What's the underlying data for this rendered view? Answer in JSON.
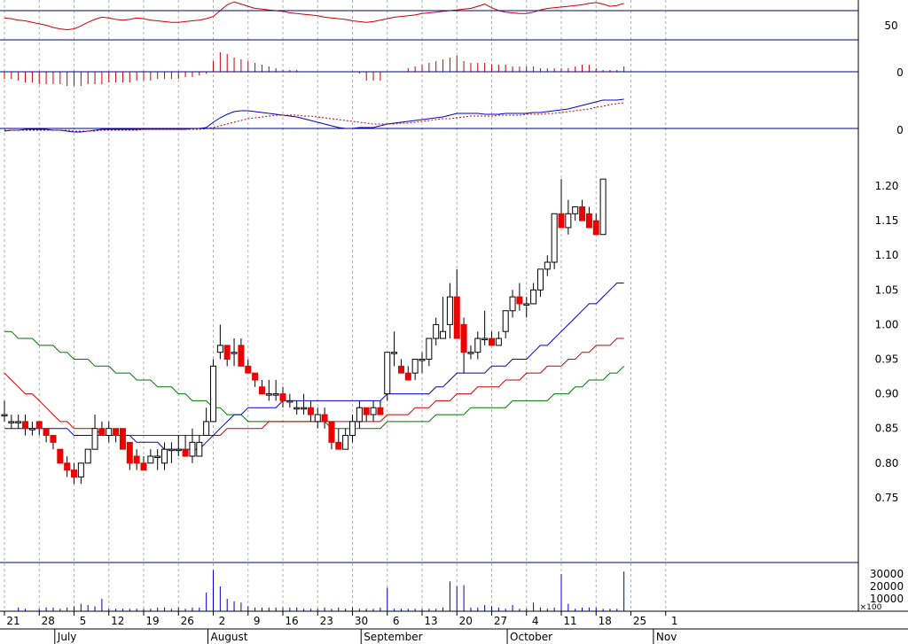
{
  "chart_data": {
    "type": "candlestick",
    "rsi_panel": {
      "ticks": [
        "50"
      ],
      "guide_levels": [
        70,
        30
      ],
      "values": [
        60,
        59,
        57,
        56,
        54,
        52,
        50,
        47,
        45,
        44,
        45,
        49,
        54,
        58,
        61,
        60,
        58,
        57,
        58,
        60,
        59,
        57,
        56,
        55,
        54,
        54,
        55,
        56,
        57,
        59,
        62,
        70,
        78,
        82,
        79,
        76,
        73,
        72,
        71,
        70,
        69,
        67,
        66,
        65,
        64,
        63,
        61,
        60,
        59,
        58,
        56,
        55,
        54,
        55,
        57,
        59,
        61,
        62,
        63,
        64,
        66,
        67,
        68,
        69,
        70,
        71,
        72,
        73,
        76,
        79,
        74,
        70,
        68,
        67,
        66,
        66,
        68,
        71,
        73,
        74,
        75,
        76,
        77,
        78,
        80,
        81,
        79,
        76,
        77,
        80
      ]
    },
    "macd_hist_panel": {
      "ticks": [
        "0"
      ],
      "values": [
        -4,
        -4,
        -5,
        -6,
        -6,
        -7,
        -7,
        -7,
        -7,
        -8,
        -8,
        -8,
        -7,
        -7,
        -7,
        -6,
        -6,
        -6,
        -6,
        -5,
        -5,
        -5,
        -4,
        -4,
        -4,
        -4,
        -3,
        -3,
        -2,
        -1,
        6,
        11,
        10,
        8,
        7,
        6,
        5,
        4,
        3,
        2,
        1,
        1,
        1,
        0,
        0,
        0,
        0,
        0,
        0,
        0,
        0,
        -1,
        -5,
        -5,
        -5,
        0,
        0,
        0,
        2,
        3,
        4,
        5,
        6,
        7,
        8,
        9,
        6,
        5,
        5,
        5,
        4,
        4,
        4,
        3,
        3,
        3,
        3,
        2,
        2,
        2,
        2,
        2,
        3,
        4,
        4,
        2,
        1,
        1,
        1,
        3
      ]
    },
    "macd_line_panel": {
      "ticks": [
        "0"
      ],
      "macd": [
        -3,
        -2,
        -2,
        -1,
        -1,
        -1,
        -1,
        -2,
        -2,
        -3,
        -4,
        -4,
        -3,
        -2,
        -1,
        -1,
        -1,
        -1,
        -1,
        -1,
        -1,
        -1,
        -1,
        -1,
        -1,
        -1,
        -1,
        0,
        0,
        1,
        7,
        12,
        16,
        19,
        20,
        20,
        19,
        18,
        17,
        16,
        15,
        14,
        13,
        11,
        9,
        7,
        5,
        3,
        1,
        0,
        0,
        1,
        1,
        1,
        3,
        5,
        6,
        7,
        8,
        9,
        10,
        11,
        12,
        13,
        15,
        17,
        17,
        17,
        17,
        16,
        16,
        16,
        17,
        17,
        17,
        17,
        18,
        18,
        19,
        20,
        21,
        22,
        24,
        26,
        28,
        30,
        32,
        32,
        32,
        33
      ],
      "signal": [
        -2,
        -2,
        -2,
        -2,
        -2,
        -2,
        -2,
        -2,
        -2,
        -2,
        -3,
        -3,
        -3,
        -3,
        -2,
        -2,
        -2,
        -2,
        -2,
        -2,
        -1,
        -1,
        -1,
        -1,
        -1,
        -1,
        -1,
        -1,
        -1,
        0,
        1,
        3,
        5,
        7,
        9,
        11,
        12,
        13,
        14,
        15,
        15,
        15,
        15,
        14,
        14,
        13,
        12,
        11,
        10,
        9,
        8,
        7,
        6,
        5,
        5,
        5,
        5,
        6,
        6,
        7,
        8,
        9,
        10,
        11,
        11,
        12,
        13,
        14,
        14,
        14,
        14,
        15,
        15,
        15,
        15,
        16,
        16,
        16,
        17,
        17,
        18,
        19,
        20,
        21,
        22,
        24,
        25,
        27,
        28,
        29
      ]
    },
    "price_panel": {
      "y_ticks": [
        "1.20",
        "1.15",
        "1.10",
        "1.05",
        "1.00",
        "0.95",
        "0.90",
        "0.85",
        "0.80",
        "0.75"
      ],
      "ylim": [
        0.73,
        1.23
      ],
      "candles": [
        [
          0.87,
          0.89,
          0.86,
          0.87
        ],
        [
          0.86,
          0.87,
          0.85,
          0.86
        ],
        [
          0.86,
          0.87,
          0.85,
          0.86
        ],
        [
          0.86,
          0.87,
          0.84,
          0.85
        ],
        [
          0.85,
          0.86,
          0.84,
          0.85
        ],
        [
          0.86,
          0.86,
          0.84,
          0.85
        ],
        [
          0.85,
          0.85,
          0.83,
          0.84
        ],
        [
          0.84,
          0.84,
          0.82,
          0.83
        ],
        [
          0.82,
          0.82,
          0.8,
          0.8
        ],
        [
          0.8,
          0.81,
          0.78,
          0.79
        ],
        [
          0.79,
          0.8,
          0.77,
          0.78
        ],
        [
          0.78,
          0.8,
          0.77,
          0.8
        ],
        [
          0.8,
          0.82,
          0.8,
          0.82
        ],
        [
          0.82,
          0.87,
          0.82,
          0.85
        ],
        [
          0.85,
          0.86,
          0.84,
          0.84
        ],
        [
          0.84,
          0.86,
          0.83,
          0.85
        ],
        [
          0.85,
          0.85,
          0.83,
          0.84
        ],
        [
          0.85,
          0.85,
          0.83,
          0.82
        ],
        [
          0.83,
          0.83,
          0.79,
          0.8
        ],
        [
          0.81,
          0.82,
          0.79,
          0.8
        ],
        [
          0.8,
          0.81,
          0.79,
          0.79
        ],
        [
          0.8,
          0.82,
          0.8,
          0.81
        ],
        [
          0.81,
          0.82,
          0.79,
          0.81
        ],
        [
          0.8,
          0.83,
          0.79,
          0.82
        ],
        [
          0.82,
          0.83,
          0.8,
          0.82
        ],
        [
          0.82,
          0.84,
          0.81,
          0.82
        ],
        [
          0.82,
          0.84,
          0.81,
          0.81
        ],
        [
          0.81,
          0.85,
          0.8,
          0.83
        ],
        [
          0.81,
          0.84,
          0.81,
          0.83
        ],
        [
          0.84,
          0.88,
          0.84,
          0.86
        ],
        [
          0.86,
          0.95,
          0.86,
          0.94
        ],
        [
          0.96,
          1.0,
          0.95,
          0.97
        ],
        [
          0.97,
          0.97,
          0.94,
          0.95
        ],
        [
          0.96,
          0.98,
          0.94,
          0.96
        ],
        [
          0.97,
          0.98,
          0.94,
          0.94
        ],
        [
          0.94,
          0.95,
          0.93,
          0.93
        ],
        [
          0.93,
          0.93,
          0.91,
          0.92
        ],
        [
          0.91,
          0.92,
          0.9,
          0.9
        ],
        [
          0.9,
          0.92,
          0.89,
          0.9
        ],
        [
          0.9,
          0.92,
          0.89,
          0.9
        ],
        [
          0.9,
          0.91,
          0.88,
          0.89
        ],
        [
          0.89,
          0.9,
          0.88,
          0.89
        ],
        [
          0.88,
          0.89,
          0.87,
          0.88
        ],
        [
          0.88,
          0.9,
          0.87,
          0.88
        ],
        [
          0.88,
          0.89,
          0.86,
          0.87
        ],
        [
          0.86,
          0.88,
          0.85,
          0.87
        ],
        [
          0.87,
          0.88,
          0.85,
          0.86
        ],
        [
          0.86,
          0.86,
          0.82,
          0.83
        ],
        [
          0.83,
          0.85,
          0.82,
          0.82
        ],
        [
          0.82,
          0.85,
          0.82,
          0.84
        ],
        [
          0.84,
          0.87,
          0.83,
          0.86
        ],
        [
          0.86,
          0.89,
          0.85,
          0.88
        ],
        [
          0.88,
          0.88,
          0.86,
          0.87
        ],
        [
          0.87,
          0.89,
          0.86,
          0.88
        ],
        [
          0.88,
          0.89,
          0.87,
          0.87
        ],
        [
          0.9,
          0.96,
          0.89,
          0.96
        ],
        [
          0.96,
          0.99,
          0.94,
          0.96
        ],
        [
          0.94,
          0.95,
          0.93,
          0.93
        ],
        [
          0.93,
          0.94,
          0.92,
          0.92
        ],
        [
          0.93,
          0.95,
          0.92,
          0.95
        ],
        [
          0.95,
          0.96,
          0.93,
          0.95
        ],
        [
          0.95,
          0.98,
          0.94,
          0.98
        ],
        [
          0.98,
          1.01,
          0.97,
          1.0
        ],
        [
          0.98,
          1.04,
          0.98,
          0.99
        ],
        [
          1.0,
          1.06,
          0.98,
          1.04
        ],
        [
          1.04,
          1.08,
          0.98,
          0.98
        ],
        [
          1.0,
          1.01,
          0.93,
          0.96
        ],
        [
          0.96,
          0.97,
          0.95,
          0.96
        ],
        [
          0.96,
          0.99,
          0.95,
          0.98
        ],
        [
          0.98,
          1.02,
          0.97,
          0.98
        ],
        [
          0.98,
          0.99,
          0.97,
          0.97
        ],
        [
          0.97,
          0.99,
          0.97,
          0.98
        ],
        [
          0.99,
          1.02,
          0.98,
          1.02
        ],
        [
          1.02,
          1.05,
          1.01,
          1.04
        ],
        [
          1.04,
          1.06,
          1.02,
          1.03
        ],
        [
          1.03,
          1.04,
          1.01,
          1.03
        ],
        [
          1.03,
          1.06,
          1.03,
          1.05
        ],
        [
          1.05,
          1.07,
          1.04,
          1.08
        ],
        [
          1.08,
          1.1,
          1.07,
          1.09
        ],
        [
          1.09,
          1.16,
          1.08,
          1.16
        ],
        [
          1.16,
          1.21,
          1.15,
          1.14
        ],
        [
          1.14,
          1.18,
          1.13,
          1.16
        ],
        [
          1.16,
          1.17,
          1.15,
          1.17
        ],
        [
          1.17,
          1.18,
          1.15,
          1.15
        ],
        [
          1.16,
          1.17,
          1.14,
          1.14
        ],
        [
          1.15,
          1.16,
          1.14,
          1.13
        ],
        [
          1.13,
          1.21,
          1.13,
          1.21
        ]
      ],
      "ma_short": [
        0.85,
        0.85,
        0.85,
        0.85,
        0.85,
        0.85,
        0.85,
        0.85,
        0.85,
        0.85,
        0.84,
        0.84,
        0.84,
        0.84,
        0.84,
        0.84,
        0.84,
        0.84,
        0.84,
        0.83,
        0.83,
        0.83,
        0.83,
        0.82,
        0.82,
        0.82,
        0.82,
        0.82,
        0.82,
        0.83,
        0.84,
        0.85,
        0.86,
        0.87,
        0.87,
        0.88,
        0.88,
        0.88,
        0.88,
        0.88,
        0.89,
        0.89,
        0.89,
        0.89,
        0.89,
        0.89,
        0.89,
        0.89,
        0.89,
        0.89,
        0.89,
        0.89,
        0.89,
        0.89,
        0.89,
        0.9,
        0.9,
        0.9,
        0.9,
        0.9,
        0.9,
        0.9,
        0.91,
        0.91,
        0.92,
        0.93,
        0.93,
        0.93,
        0.93,
        0.93,
        0.94,
        0.94,
        0.94,
        0.95,
        0.95,
        0.95,
        0.96,
        0.97,
        0.97,
        0.98,
        0.99,
        1.0,
        1.01,
        1.02,
        1.03,
        1.03,
        1.04,
        1.05,
        1.06,
        1.06
      ],
      "ma_mid": [
        0.93,
        0.92,
        0.91,
        0.9,
        0.9,
        0.89,
        0.88,
        0.87,
        0.86,
        0.86,
        0.85,
        0.85,
        0.85,
        0.85,
        0.84,
        0.84,
        0.84,
        0.84,
        0.84,
        0.84,
        0.84,
        0.84,
        0.84,
        0.84,
        0.84,
        0.84,
        0.84,
        0.84,
        0.84,
        0.84,
        0.84,
        0.84,
        0.85,
        0.85,
        0.85,
        0.85,
        0.85,
        0.85,
        0.86,
        0.86,
        0.86,
        0.86,
        0.86,
        0.86,
        0.86,
        0.86,
        0.86,
        0.86,
        0.86,
        0.86,
        0.86,
        0.86,
        0.86,
        0.86,
        0.86,
        0.87,
        0.87,
        0.87,
        0.87,
        0.88,
        0.88,
        0.88,
        0.89,
        0.89,
        0.89,
        0.9,
        0.9,
        0.9,
        0.91,
        0.91,
        0.91,
        0.91,
        0.92,
        0.92,
        0.92,
        0.93,
        0.93,
        0.93,
        0.94,
        0.94,
        0.94,
        0.95,
        0.95,
        0.96,
        0.96,
        0.97,
        0.97,
        0.97,
        0.98,
        0.98
      ],
      "ma_long": [
        0.99,
        0.99,
        0.98,
        0.98,
        0.98,
        0.97,
        0.97,
        0.97,
        0.96,
        0.96,
        0.95,
        0.95,
        0.95,
        0.94,
        0.94,
        0.94,
        0.93,
        0.93,
        0.93,
        0.92,
        0.92,
        0.92,
        0.91,
        0.91,
        0.91,
        0.9,
        0.9,
        0.89,
        0.89,
        0.89,
        0.88,
        0.88,
        0.87,
        0.87,
        0.87,
        0.86,
        0.86,
        0.86,
        0.86,
        0.86,
        0.86,
        0.86,
        0.86,
        0.86,
        0.86,
        0.86,
        0.86,
        0.85,
        0.85,
        0.85,
        0.85,
        0.85,
        0.85,
        0.85,
        0.85,
        0.86,
        0.86,
        0.86,
        0.86,
        0.86,
        0.86,
        0.86,
        0.87,
        0.87,
        0.87,
        0.87,
        0.87,
        0.88,
        0.88,
        0.88,
        0.88,
        0.88,
        0.88,
        0.89,
        0.89,
        0.89,
        0.89,
        0.89,
        0.89,
        0.9,
        0.9,
        0.9,
        0.91,
        0.91,
        0.92,
        0.92,
        0.92,
        0.93,
        0.93,
        0.94
      ]
    },
    "volume_panel": {
      "ticks": [
        "30000",
        "20000",
        "10000"
      ],
      "multiplier_label": "×100",
      "values": [
        0,
        0,
        3000,
        2000,
        0,
        2000,
        3000,
        3000,
        2000,
        3000,
        4000,
        6000,
        5000,
        4000,
        10000,
        2000,
        2000,
        2000,
        2000,
        2000,
        2000,
        2000,
        3000,
        3000,
        2000,
        3000,
        2000,
        3000,
        3000,
        15000,
        33000,
        20000,
        10000,
        8000,
        7000,
        4000,
        3000,
        3000,
        3000,
        3000,
        3000,
        3000,
        3000,
        2000,
        2000,
        2000,
        3000,
        2000,
        3000,
        2000,
        3000,
        2000,
        2000,
        2000,
        3000,
        19000,
        2000,
        2000,
        2000,
        2000,
        2000,
        2000,
        2000,
        3000,
        24000,
        20000,
        21000,
        3000,
        3000,
        5000,
        4000,
        3000,
        2000,
        5000,
        2000,
        2000,
        7000,
        3000,
        2000,
        3000,
        30000,
        6000,
        2000,
        3000,
        3000,
        3000,
        2000,
        2000,
        2000,
        32000
      ]
    },
    "x_ticks": [
      {
        "i": 0,
        "label": "21"
      },
      {
        "i": 5,
        "label": "28"
      },
      {
        "i": 10,
        "label": "5"
      },
      {
        "i": 15,
        "label": "12"
      },
      {
        "i": 20,
        "label": "19"
      },
      {
        "i": 25,
        "label": "26"
      },
      {
        "i": 30,
        "label": "2"
      },
      {
        "i": 35,
        "label": "9"
      },
      {
        "i": 40,
        "label": "16"
      },
      {
        "i": 45,
        "label": "23"
      },
      {
        "i": 50,
        "label": "30"
      },
      {
        "i": 55,
        "label": "6"
      },
      {
        "i": 60,
        "label": "13"
      },
      {
        "i": 65,
        "label": "20"
      },
      {
        "i": 70,
        "label": "27"
      },
      {
        "i": 75,
        "label": "4"
      },
      {
        "i": 80,
        "label": "11"
      },
      {
        "i": 85,
        "label": "18"
      },
      {
        "i": 90,
        "label": "25"
      },
      {
        "i": 95,
        "label": "1"
      }
    ],
    "months": [
      {
        "i": 8,
        "label": "July"
      },
      {
        "i": 30,
        "label": "August"
      },
      {
        "i": 52,
        "label": "September"
      },
      {
        "i": 73,
        "label": "October"
      },
      {
        "i": 94,
        "label": "Nov"
      }
    ],
    "colors": {
      "grid": "#b0b0b0",
      "panel_line": "#000080",
      "rsi": "#cc0000",
      "macd_hist": "#cc0000",
      "macd": "#0000cc",
      "signal": "#cc0000",
      "ma_short": "#0000cc",
      "ma_mid": "#cc0000",
      "ma_long": "#007700",
      "up_candle": "#ffffff",
      "down_candle": "#ee0000",
      "volume": "#0000cc"
    }
  }
}
